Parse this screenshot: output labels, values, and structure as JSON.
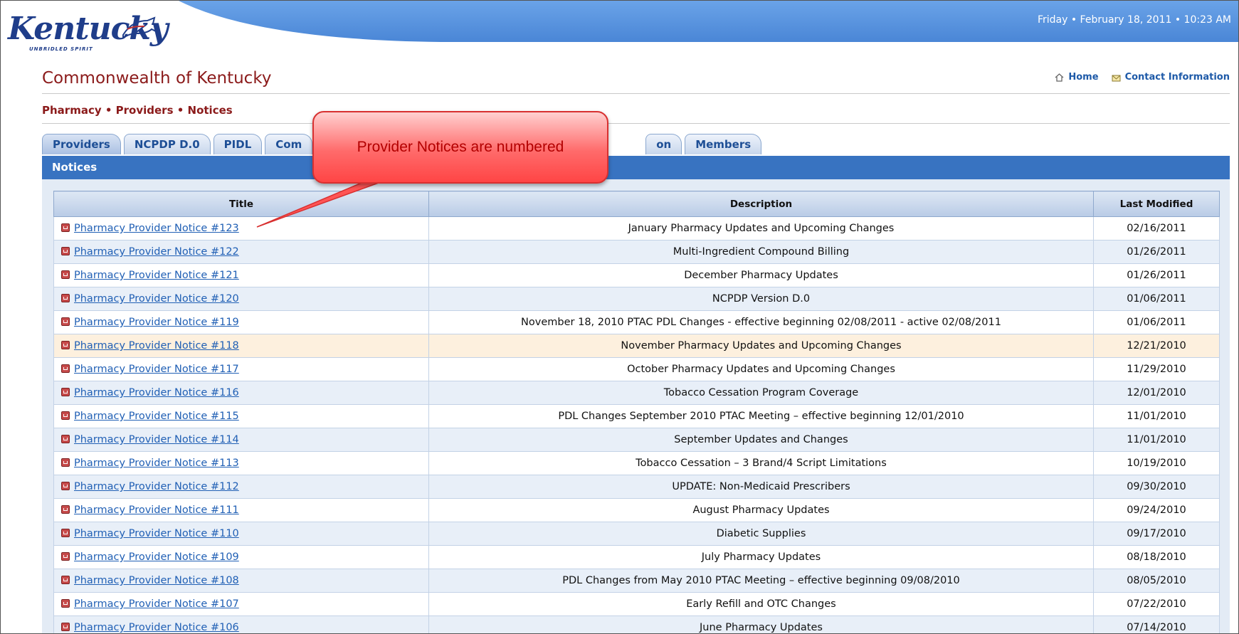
{
  "header": {
    "datetime": "Friday • February 18, 2011 • 10:23 AM",
    "logo_text": "Kentucky",
    "logo_tagline": "UNBRIDLED SPIRIT",
    "site_title": "Commonwealth of Kentucky",
    "home_label": "Home",
    "contact_label": "Contact Information",
    "breadcrumb": "Pharmacy • Providers • Notices"
  },
  "tabs": [
    {
      "label": "Providers"
    },
    {
      "label": "NCPDP D.0"
    },
    {
      "label": "PIDL"
    },
    {
      "label": "Com"
    },
    {
      "label": "on"
    },
    {
      "label": "Members"
    }
  ],
  "section_title": "Notices",
  "callout_text": "Provider Notices are numbered",
  "table": {
    "headers": [
      "Title",
      "Description",
      "Last Modified"
    ],
    "rows": [
      {
        "title": "Pharmacy Provider Notice #123",
        "desc": "January Pharmacy Updates and Upcoming Changes",
        "date": "02/16/2011"
      },
      {
        "title": "Pharmacy Provider Notice #122",
        "desc": "Multi-Ingredient Compound Billing",
        "date": "01/26/2011"
      },
      {
        "title": "Pharmacy Provider Notice #121",
        "desc": "December Pharmacy Updates",
        "date": "01/26/2011"
      },
      {
        "title": "Pharmacy Provider Notice #120",
        "desc": "NCPDP Version D.0",
        "date": "01/06/2011"
      },
      {
        "title": "Pharmacy Provider Notice #119",
        "desc": "November 18, 2010 PTAC PDL Changes - effective beginning 02/08/2011 - active 02/08/2011",
        "date": "01/06/2011"
      },
      {
        "title": "Pharmacy Provider Notice #118",
        "desc": "November Pharmacy Updates and Upcoming Changes",
        "date": "12/21/2010"
      },
      {
        "title": "Pharmacy Provider Notice #117",
        "desc": "October Pharmacy Updates and Upcoming Changes",
        "date": "11/29/2010"
      },
      {
        "title": "Pharmacy Provider Notice #116",
        "desc": "Tobacco Cessation Program Coverage",
        "date": "12/01/2010"
      },
      {
        "title": "Pharmacy Provider Notice #115",
        "desc": "PDL Changes September 2010 PTAC Meeting – effective beginning 12/01/2010",
        "date": "11/01/2010"
      },
      {
        "title": "Pharmacy Provider Notice #114",
        "desc": "September Updates and Changes",
        "date": "11/01/2010"
      },
      {
        "title": "Pharmacy Provider Notice #113",
        "desc": "Tobacco Cessation – 3 Brand/4 Script Limitations",
        "date": "10/19/2010"
      },
      {
        "title": "Pharmacy Provider Notice #112",
        "desc": "UPDATE: Non-Medicaid Prescribers",
        "date": "09/30/2010"
      },
      {
        "title": "Pharmacy Provider Notice #111",
        "desc": "August Pharmacy Updates",
        "date": "09/24/2010"
      },
      {
        "title": "Pharmacy Provider Notice #110",
        "desc": "Diabetic Supplies",
        "date": "09/17/2010"
      },
      {
        "title": "Pharmacy Provider Notice #109",
        "desc": "July Pharmacy Updates",
        "date": "08/18/2010"
      },
      {
        "title": "Pharmacy Provider Notice #108",
        "desc": "PDL Changes from May 2010 PTAC Meeting – effective beginning 09/08/2010",
        "date": "08/05/2010"
      },
      {
        "title": "Pharmacy Provider Notice #107",
        "desc": "Early Refill and OTC Changes",
        "date": "07/22/2010"
      },
      {
        "title": "Pharmacy Provider Notice #106",
        "desc": "June Pharmacy Updates",
        "date": "07/14/2010"
      }
    ]
  }
}
